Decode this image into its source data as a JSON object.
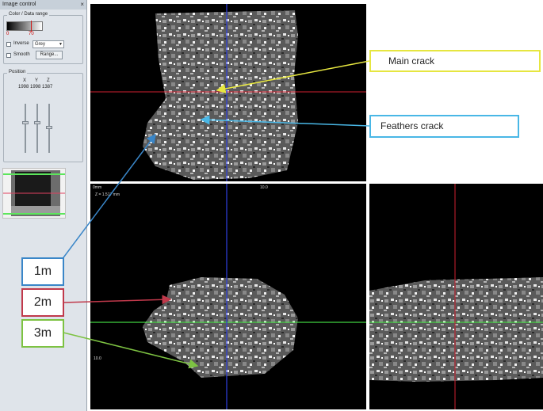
{
  "panel": {
    "title": "Image control",
    "close_glyph": "×",
    "color_group": {
      "label": "Color / Data range",
      "min_value": "0",
      "max_value": "70",
      "inverse_label": "Inverse",
      "colormap_value": "Grey",
      "smooth_label": "Smooth",
      "range_button": "Range..."
    },
    "position_group": {
      "label": "Position",
      "axes": [
        {
          "name": "X",
          "value": "1998",
          "level": 0.35
        },
        {
          "name": "Y",
          "value": "1998",
          "level": 0.35
        },
        {
          "name": "Z",
          "value": "1387",
          "level": 0.45
        }
      ]
    }
  },
  "views": {
    "bottom_left_top_text": "0mm",
    "bottom_left_center_text": "10.0",
    "bottom_left_z_text": "Z = 1.517 mm",
    "bottom_left_side_text": "10.0"
  },
  "annotations": {
    "main_crack": {
      "label": "Main crack",
      "color": "#e6e640"
    },
    "feathers_crack": {
      "label": "Feathers crack",
      "color": "#49b7e6"
    },
    "label_1m": {
      "label": "1m",
      "color": "#3a86c8"
    },
    "label_2m": {
      "label": "2m",
      "color": "#c0394b"
    },
    "label_3m": {
      "label": "3m",
      "color": "#7dc242"
    }
  }
}
